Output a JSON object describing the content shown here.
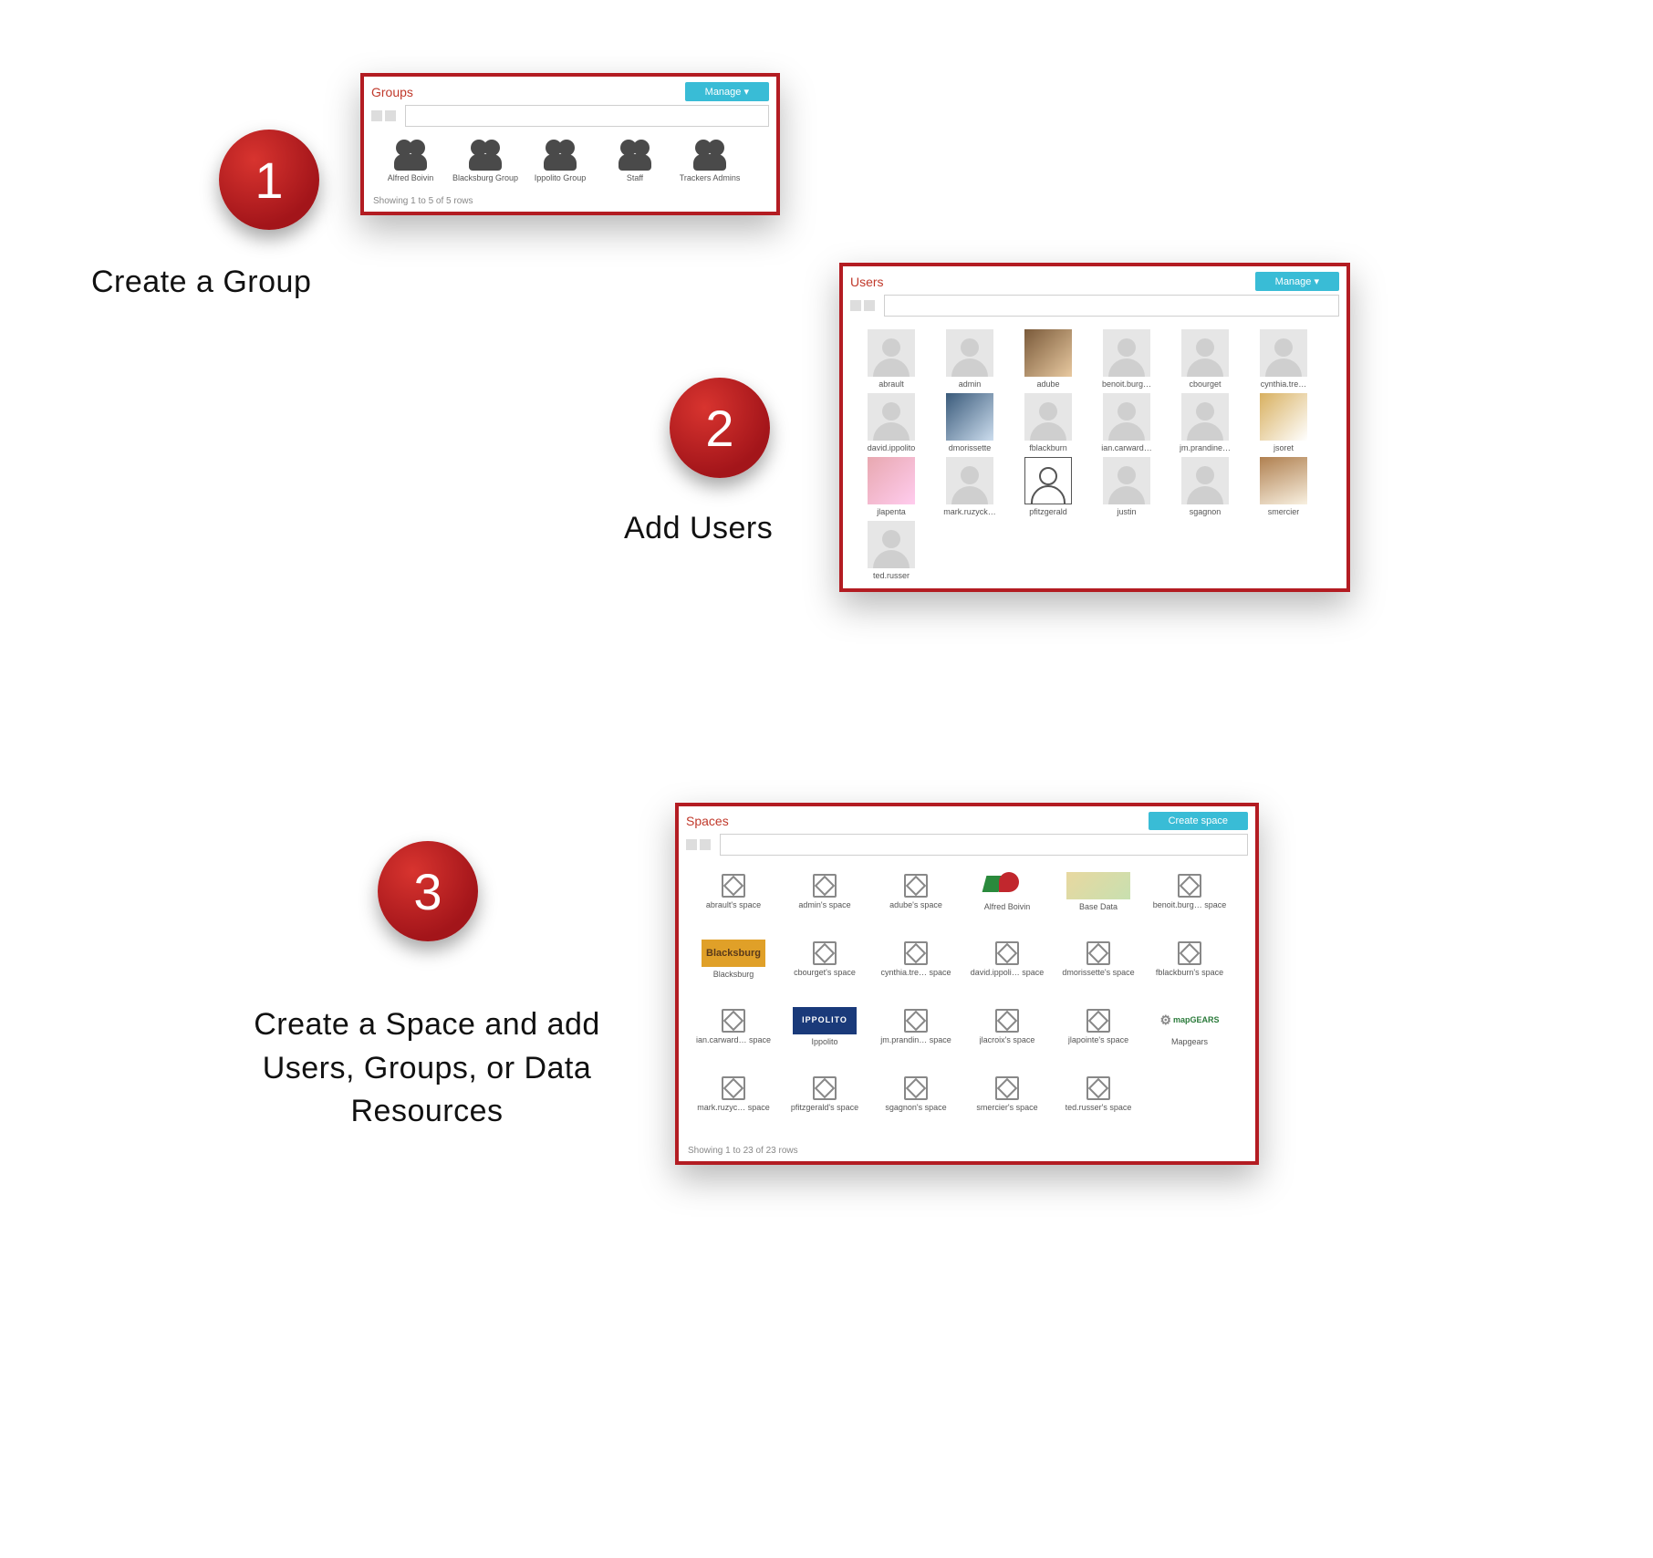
{
  "steps": {
    "one": {
      "num": "1",
      "label": "Create a Group"
    },
    "two": {
      "num": "2",
      "label": "Add Users"
    },
    "three": {
      "num": "3",
      "label": "Create a Space and add Users, Groups, or Data Resources"
    }
  },
  "groups_panel": {
    "title": "Groups",
    "button": "Manage ▾",
    "footer": "Showing 1 to 5 of 5 rows",
    "items": [
      {
        "label": "Alfred Boivin"
      },
      {
        "label": "Blacksburg Group"
      },
      {
        "label": "Ippolito Group"
      },
      {
        "label": "Staff"
      },
      {
        "label": "Trackers Admins"
      }
    ]
  },
  "users_panel": {
    "title": "Users",
    "button": "Manage ▾",
    "items": [
      {
        "label": "abrault",
        "variant": ""
      },
      {
        "label": "admin",
        "variant": ""
      },
      {
        "label": "adube",
        "variant": "photo1"
      },
      {
        "label": "benoit.burg…",
        "variant": ""
      },
      {
        "label": "cbourget",
        "variant": ""
      },
      {
        "label": "cynthia.tre…",
        "variant": ""
      },
      {
        "label": "david.ippolito",
        "variant": ""
      },
      {
        "label": "dmorissette",
        "variant": "photo2"
      },
      {
        "label": "fblackburn",
        "variant": ""
      },
      {
        "label": "ian.carward…",
        "variant": ""
      },
      {
        "label": "jm.prandine…",
        "variant": ""
      },
      {
        "label": "jsoret",
        "variant": "photo3"
      },
      {
        "label": "jlapenta",
        "variant": "photo4"
      },
      {
        "label": "mark.ruzyck…",
        "variant": ""
      },
      {
        "label": "pfitzgerald",
        "variant": "outline"
      },
      {
        "label": "justin",
        "variant": ""
      },
      {
        "label": "sgagnon",
        "variant": ""
      },
      {
        "label": "smercier",
        "variant": "photo5"
      },
      {
        "label": "ted.russer",
        "variant": ""
      }
    ]
  },
  "spaces_panel": {
    "title": "Spaces",
    "button": "Create space",
    "footer": "Showing 1 to 23 of 23 rows",
    "items": [
      {
        "label": "abrault's space",
        "variant": "cube"
      },
      {
        "label": "admin's space",
        "variant": "cube"
      },
      {
        "label": "adube's space",
        "variant": "cube"
      },
      {
        "label": "Alfred Boivin",
        "variant": "logo-ab"
      },
      {
        "label": "Base Data",
        "variant": "logo-map"
      },
      {
        "label": "benoit.burg… space",
        "variant": "cube"
      },
      {
        "label": "Blacksburg",
        "variant": "logo-blacksburg"
      },
      {
        "label": "cbourget's space",
        "variant": "cube"
      },
      {
        "label": "cynthia.tre… space",
        "variant": "cube"
      },
      {
        "label": "david.ippoli… space",
        "variant": "cube"
      },
      {
        "label": "dmorissette's space",
        "variant": "cube"
      },
      {
        "label": "fblackburn's space",
        "variant": "cube"
      },
      {
        "label": "ian.carward… space",
        "variant": "cube"
      },
      {
        "label": "Ippolito",
        "variant": "logo-ippolito"
      },
      {
        "label": "jm.prandin… space",
        "variant": "cube"
      },
      {
        "label": "jlacroix's space",
        "variant": "cube"
      },
      {
        "label": "jlapointe's space",
        "variant": "cube"
      },
      {
        "label": "Mapgears",
        "variant": "logo-mapgears"
      },
      {
        "label": "mark.ruzyc… space",
        "variant": "cube"
      },
      {
        "label": "pfitzgerald's space",
        "variant": "cube"
      },
      {
        "label": "sgagnon's space",
        "variant": "cube"
      },
      {
        "label": "smercier's space",
        "variant": "cube"
      },
      {
        "label": "ted.russer's space",
        "variant": "cube"
      }
    ]
  }
}
